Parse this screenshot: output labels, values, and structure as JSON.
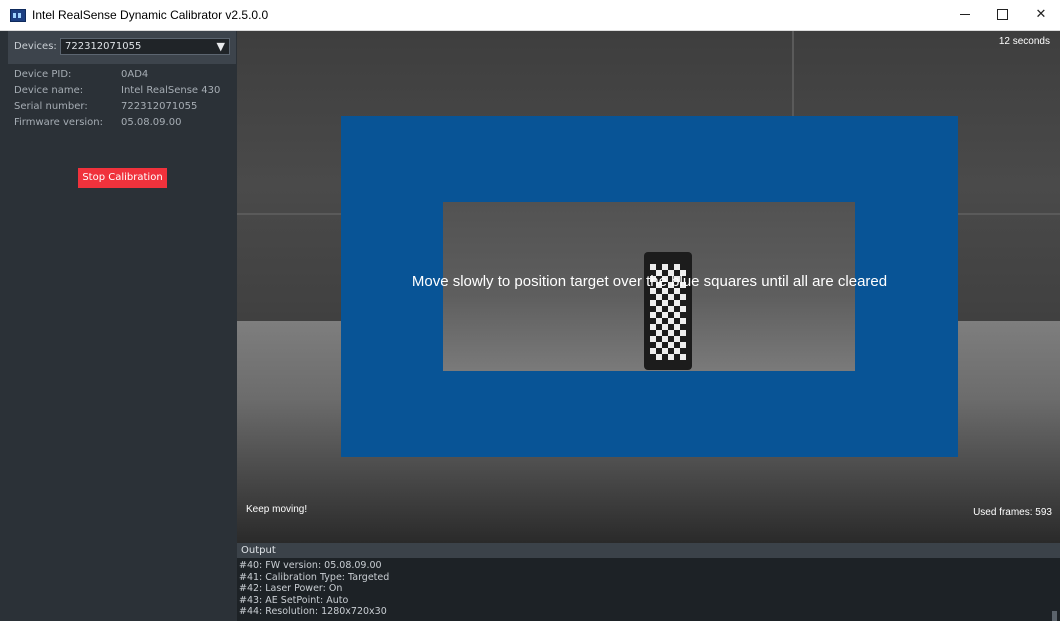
{
  "window": {
    "title": "Intel RealSense Dynamic Calibrator v2.5.0.0",
    "controls": [
      "minimize-icon",
      "maximize-icon",
      "close-icon"
    ],
    "close_glyph": "✕"
  },
  "sidebar": {
    "devices_label": "Devices:",
    "selected_device": "722312071055",
    "dropdown_caret": "▼",
    "info": [
      {
        "label": "Device PID:",
        "value": "0AD4"
      },
      {
        "label": "Device name:",
        "value": "Intel RealSense 430"
      },
      {
        "label": "Serial number:",
        "value": "722312071055"
      },
      {
        "label": "Firmware version:",
        "value": "05.08.09.00"
      }
    ],
    "stop_button_label": "Stop Calibration"
  },
  "video": {
    "timer": "12 seconds",
    "instruction": "Move slowly to position target over the blue squares until all are cleared",
    "status": "Keep moving!",
    "used_frames": "Used frames: 593"
  },
  "output": {
    "title": "Output",
    "lines": [
      "#40: FW version: 05.08.09.00",
      "#41: Calibration Type: Targeted",
      "#42: Laser Power: On",
      "#43: AE SetPoint: Auto",
      "#44: Resolution: 1280x720x30"
    ]
  },
  "colors": {
    "accent_blue": "#085496",
    "stop_button": "#f0323c",
    "sidebar_bg": "#2b3137",
    "output_bg": "#1d2226"
  }
}
